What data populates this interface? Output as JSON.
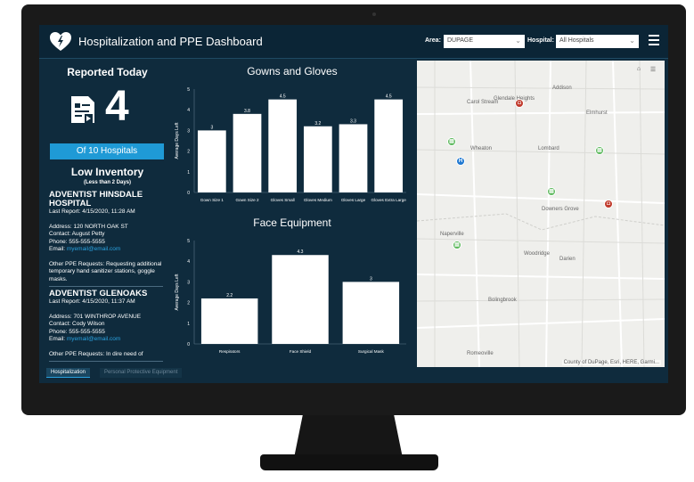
{
  "header": {
    "title": "Hospitalization and PPE Dashboard",
    "area_label": "Area:",
    "area_value": "DUPAGE",
    "hospital_label": "Hospital:",
    "hospital_value": "All Hospitals"
  },
  "summary": {
    "reported_title": "Reported Today",
    "reported_count": "4",
    "of_hospitals": "Of 10 Hospitals",
    "low_inventory_title": "Low Inventory",
    "low_inventory_sub": "(Less than 2 Days)"
  },
  "reports": [
    {
      "name": "ADVENTIST HINSDALE HOSPITAL",
      "last_report": "Last Report: 4/15/2020, 11:28 AM",
      "address": "Address: 120 NORTH OAK ST",
      "contact": "Contact: August Petty",
      "phone": "Phone: 555-555-5555",
      "email_label": "Email:",
      "email": "myemail@email.com",
      "other": "Other PPE Requests: Requesting additional temporary hand sanitizer stations, goggle masks."
    },
    {
      "name": "ADVENTIST GLENOAKS",
      "last_report": "Last Report: 4/15/2020, 11:37 AM",
      "address": "Address: 701 WINTHROP AVENUE",
      "contact": "Contact: Cody Wilson",
      "phone": "Phone: 555-555-5555",
      "email_label": "Email:",
      "email": "myemail@email.com",
      "other": "Other PPE Requests: In dire need of"
    }
  ],
  "chart_data": [
    {
      "type": "bar",
      "title": "Gowns and Gloves",
      "ylabel": "Average Days Left",
      "categories": [
        "Gown Size 1",
        "Gown Size 2",
        "Gloves Small",
        "Gloves Medium",
        "Gloves Large",
        "Gloves Extra Large"
      ],
      "values": [
        3,
        3.8,
        4.5,
        3.2,
        3.3,
        4.5
      ],
      "yticks": [
        0,
        1,
        2,
        3,
        4,
        5
      ],
      "ylim": [
        0,
        5
      ]
    },
    {
      "type": "bar",
      "title": "Face Equipment",
      "ylabel": "Average Days Left",
      "categories": [
        "Respirators",
        "Face Shield",
        "Surgical Mask"
      ],
      "values": [
        2.2,
        4.3,
        3
      ],
      "yticks": [
        0,
        1,
        2,
        3,
        4,
        5
      ],
      "ylim": [
        0,
        5
      ]
    }
  ],
  "map": {
    "places": [
      "Addison",
      "Carol Stream",
      "Glendale Heights",
      "Elmhurst",
      "Wheaton",
      "Lombard",
      "Downers Grove",
      "Naperville",
      "Woodridge",
      "Darien",
      "Bolingbrook",
      "Romeoville"
    ],
    "attribution": "County of DuPage, Esri, HERE, Garmi...",
    "home_icon": "home-icon",
    "list_icon": "list-icon"
  },
  "tabs": {
    "active": "Hospitalization",
    "inactive": "Personal Protective Equipment"
  },
  "colors": {
    "screen_bg": "#0f2b3d",
    "accent": "#1f9ad6",
    "marker_green": "#5cb85c",
    "marker_red": "#c0392b",
    "marker_blue": "#1f78d1"
  }
}
